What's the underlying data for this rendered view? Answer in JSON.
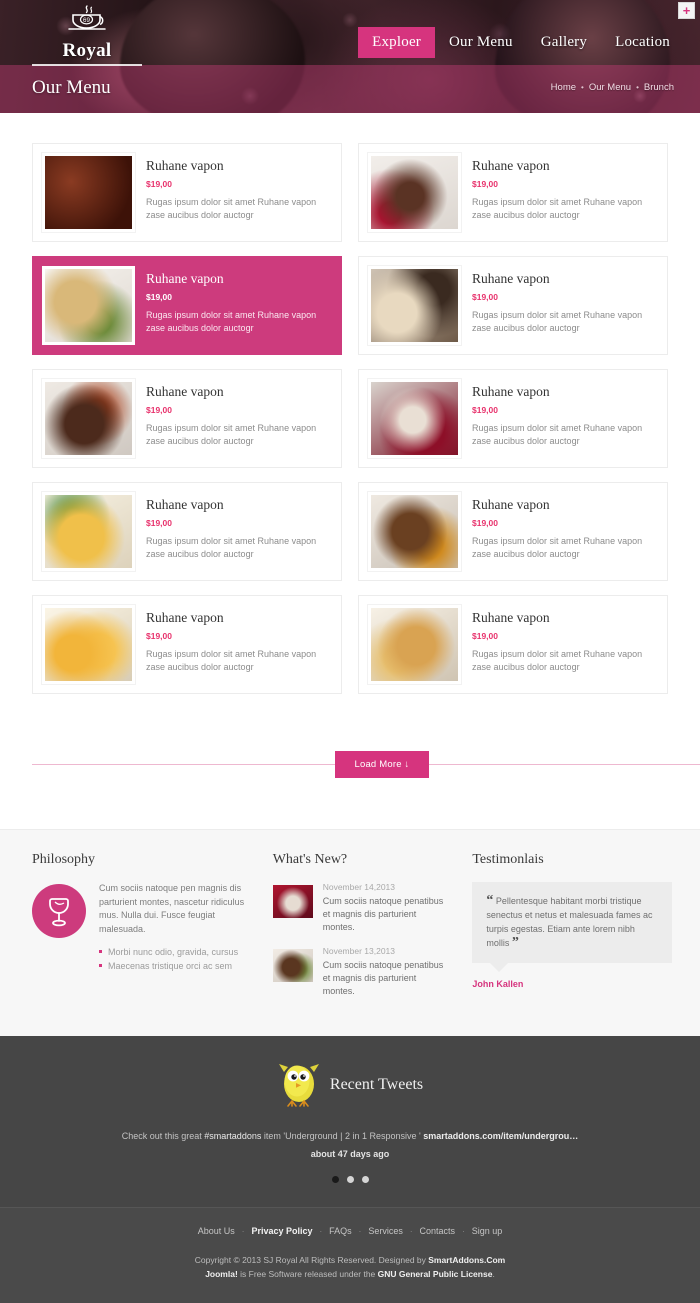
{
  "header": {
    "brand_name": "Royal",
    "brand_icon": "coffee-cup-icon",
    "cup_number": "69",
    "plus_icon": "plus-icon",
    "nav": [
      {
        "label": "Exploer",
        "active": true
      },
      {
        "label": "Our Menu",
        "active": false
      },
      {
        "label": "Gallery",
        "active": false
      },
      {
        "label": "Location",
        "active": false
      }
    ],
    "page_title": "Our Menu",
    "breadcrumb": [
      "Home",
      "Our Menu",
      "Brunch"
    ],
    "breadcrumb_separator": "•"
  },
  "menu": {
    "items": [
      {
        "title": "Ruhane vapon",
        "price": "$19,00",
        "desc": "Rugas ipsum dolor sit amet Ruhane vapon zase aucibus dolor auctogr",
        "featured": false,
        "thumb": "grilled-meat-on-fork"
      },
      {
        "title": "Ruhane vapon",
        "price": "$19,00",
        "desc": "Rugas ipsum dolor sit amet Ruhane vapon zase aucibus dolor auctogr",
        "featured": false,
        "thumb": "chocolate-lava-cake-raspberries"
      },
      {
        "title": "Ruhane vapon",
        "price": "$19,00",
        "desc": "Rugas ipsum dolor sit amet Ruhane vapon zase aucibus dolor auctogr",
        "featured": true,
        "thumb": "grilled-chicken-asparagus"
      },
      {
        "title": "Ruhane vapon",
        "price": "$19,00",
        "desc": "Rugas ipsum dolor sit amet Ruhane vapon zase aucibus dolor auctogr",
        "featured": false,
        "thumb": "seafood-plate-wine"
      },
      {
        "title": "Ruhane vapon",
        "price": "$19,00",
        "desc": "Rugas ipsum dolor sit amet Ruhane vapon zase aucibus dolor auctogr",
        "featured": false,
        "thumb": "sliced-steak-salsa"
      },
      {
        "title": "Ruhane vapon",
        "price": "$19,00",
        "desc": "Rugas ipsum dolor sit amet Ruhane vapon zase aucibus dolor auctogr",
        "featured": false,
        "thumb": "berry-dessert-red-sauce"
      },
      {
        "title": "Ruhane vapon",
        "price": "$19,00",
        "desc": "Rugas ipsum dolor sit amet Ruhane vapon zase aucibus dolor auctogr",
        "featured": false,
        "thumb": "citrus-dessert-mint"
      },
      {
        "title": "Ruhane vapon",
        "price": "$19,00",
        "desc": "Rugas ipsum dolor sit amet Ruhane vapon zase aucibus dolor auctogr",
        "featured": false,
        "thumb": "meat-stack-vegetables"
      },
      {
        "title": "Ruhane vapon",
        "price": "$19,00",
        "desc": "Rugas ipsum dolor sit amet Ruhane vapon zase aucibus dolor auctogr",
        "featured": false,
        "thumb": "mango-smoothie-glasses"
      },
      {
        "title": "Ruhane vapon",
        "price": "$19,00",
        "desc": "Rugas ipsum dolor sit amet Ruhane vapon zase aucibus dolor auctogr",
        "featured": false,
        "thumb": "fried-chicken-fries"
      }
    ],
    "load_more_label": "Load More ↓"
  },
  "widgets": {
    "philosophy": {
      "title": "Philosophy",
      "icon": "wine-glass-icon",
      "text": "Cum sociis natoque pen magnis dis parturient montes, nascetur ridiculus mus. Nulla dui. Fusce feugiat malesuada.",
      "list": [
        "Morbi nunc odio, gravida, cursus",
        "Maecenas tristique orci ac sem"
      ]
    },
    "news": {
      "title": "What's New?",
      "items": [
        {
          "date": "November 14,2013",
          "text": "Cum sociis natoque penatibus et magnis dis parturient montes.",
          "thumb": "dessert-red-sauce"
        },
        {
          "date": "November 13,2013",
          "text": "Cum sociis natoque penatibus et magnis dis parturient montes.",
          "thumb": "meat-plate-garnish"
        }
      ]
    },
    "testimonials": {
      "title": "Testimonlais",
      "quote_open": "“",
      "quote_close": "”",
      "quote": "Pellentesque habitant morbi tristique senectus et netus et malesuada fames ac turpis egestas. Etiam ante lorem nibh mollis",
      "author": "John Kallen"
    }
  },
  "tweets": {
    "title": "Recent Tweets",
    "bird_icon": "twitter-bird-icon",
    "text_prefix": "Check out this great ",
    "hashtag": "#smartaddons",
    "text_middle": " item 'Underground | 2 in 1 Responsive ' ",
    "link": "smartaddons.com/item/undergrou…",
    "time": "about 47 days ago",
    "dots": 3,
    "active_dot": 0
  },
  "footer": {
    "links": [
      {
        "label": "About Us",
        "bold": false
      },
      {
        "label": "Privacy Policy",
        "bold": true
      },
      {
        "label": "FAQs",
        "bold": false
      },
      {
        "label": "Services",
        "bold": false
      },
      {
        "label": "Contacts",
        "bold": false
      },
      {
        "label": "Sign up",
        "bold": false
      }
    ],
    "separator": "·",
    "copyright_pre": "Copyright © 2013 SJ Royal All Rights Reserved. Designed by ",
    "copyright_brand": "SmartAddons.Com",
    "license_a": "Joomla!",
    "license_mid": " is Free Software released under the ",
    "license_b": "GNU General Public License",
    "license_end": "."
  },
  "colors": {
    "accent_pink": "#d6347e",
    "featured_card": "#cd3b7d",
    "price": "#e8336d",
    "dark_tweets": "#464646",
    "footer": "#4a4a4a"
  }
}
